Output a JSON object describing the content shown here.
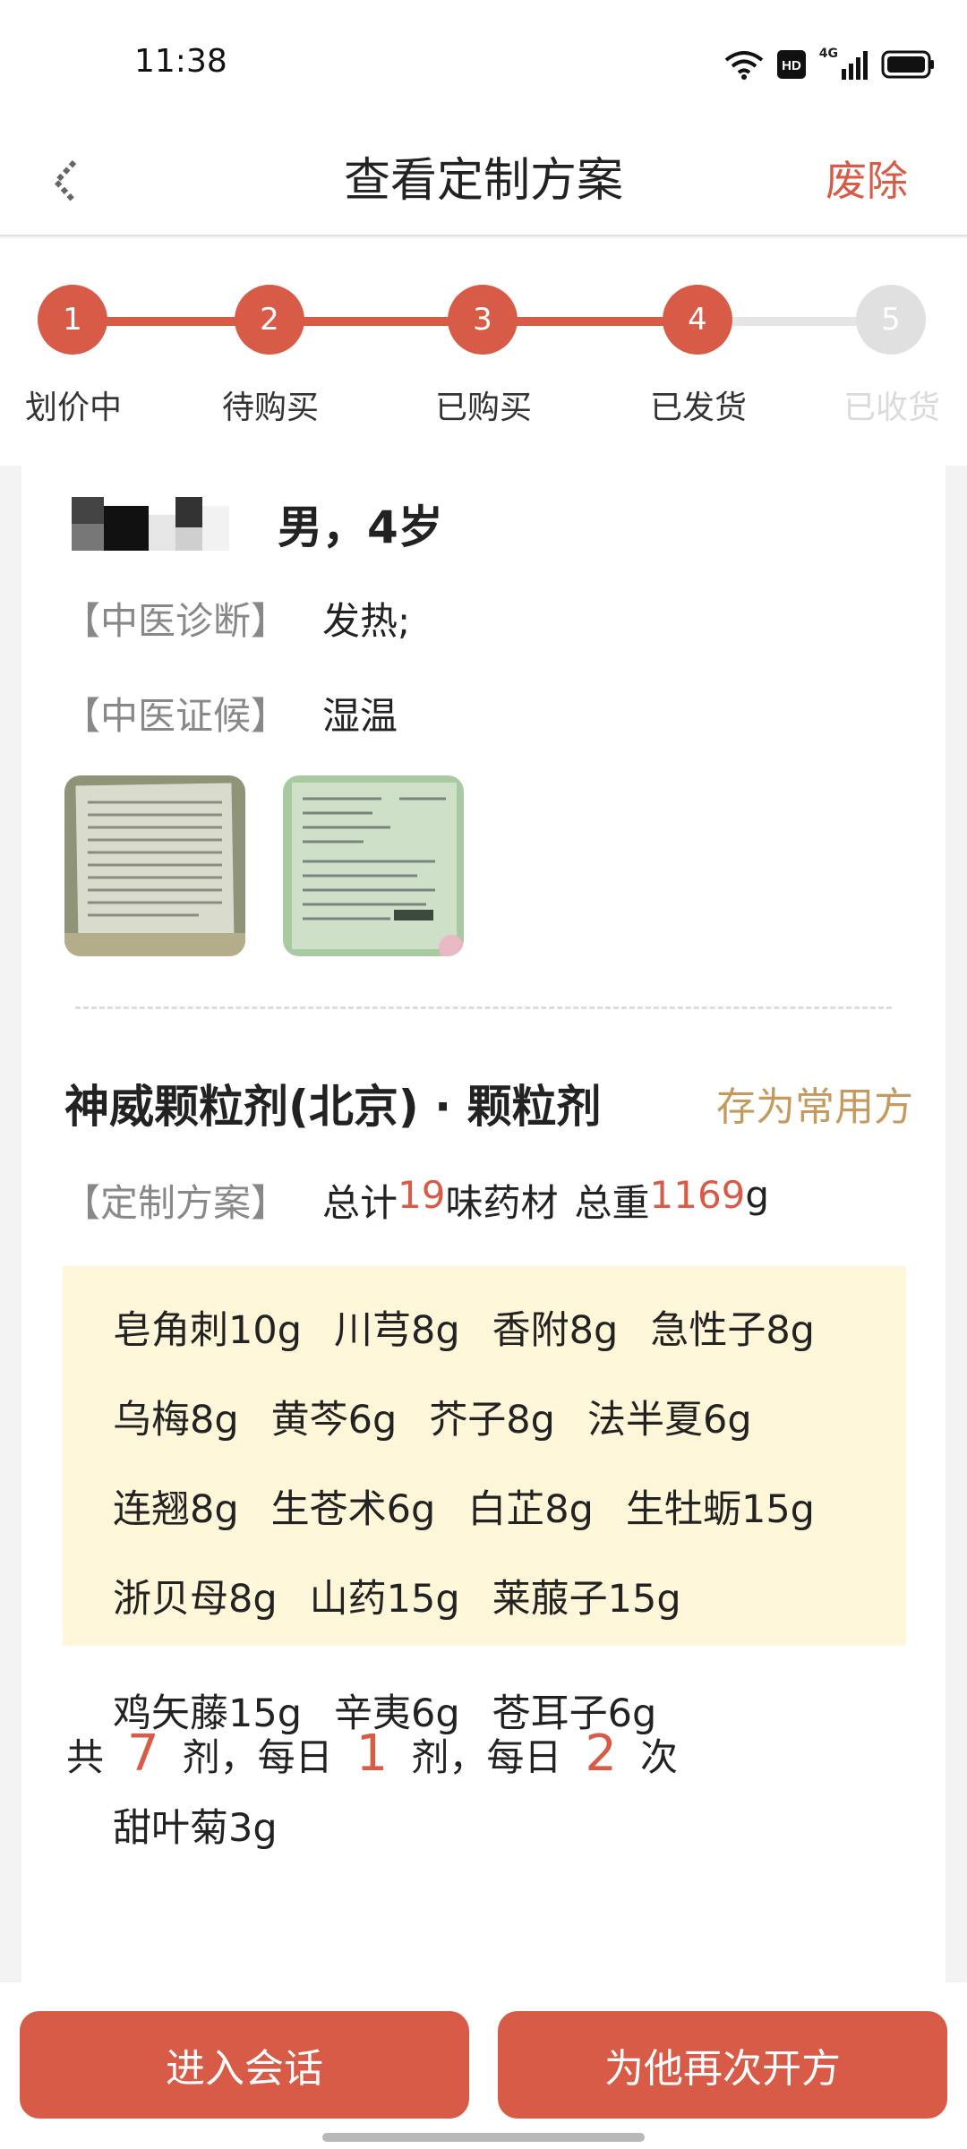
{
  "status_bar": {
    "time": "11:38",
    "network": "4G"
  },
  "nav": {
    "title": "查看定制方案",
    "action": "废除"
  },
  "steps": [
    {
      "number": "1",
      "label": "划价中",
      "done": true
    },
    {
      "number": "2",
      "label": "待购买",
      "done": true
    },
    {
      "number": "3",
      "label": "已购买",
      "done": true
    },
    {
      "number": "4",
      "label": "已发货",
      "done": true
    },
    {
      "number": "5",
      "label": "已收货",
      "done": false
    }
  ],
  "patient": {
    "info": "男，4岁"
  },
  "diagnosis": {
    "label": "【中医诊断】",
    "value": "发热;"
  },
  "syndrome": {
    "label": "【中医证候】",
    "value": "湿温"
  },
  "prescription": {
    "title": "神威颗粒剂(北京) · 颗粒剂",
    "save_label": "存为常用方",
    "summary_label": "【定制方案】",
    "total_prefix": "总计",
    "herb_count": "19",
    "herb_unit": "味药材",
    "weight_prefix": "总重",
    "total_weight": "1169",
    "weight_unit": "g",
    "herbs": [
      "皂角刺10g",
      "川芎8g",
      "香附8g",
      "急性子8g",
      "乌梅8g",
      "黄芩6g",
      "芥子8g",
      "法半夏6g",
      "连翘8g",
      "生苍术6g",
      "白芷8g",
      "生牡蛎15g",
      "浙贝母8g",
      "山药15g",
      "莱菔子15g",
      "鸡矢藤15g",
      "辛夷6g",
      "苍耳子6g",
      "甜叶菊3g"
    ]
  },
  "dosage": {
    "t1": "共",
    "doses": "7",
    "t2": "剂，每日",
    "per_day": "1",
    "t3": "剂，每日",
    "times": "2",
    "t4": "次"
  },
  "bottom": {
    "chat_label": "进入会话",
    "represcribe_label": "为他再次开方"
  },
  "colors": {
    "accent": "#d85b47",
    "gold": "#c49a5e",
    "herb_bg": "#fdf6d8"
  }
}
